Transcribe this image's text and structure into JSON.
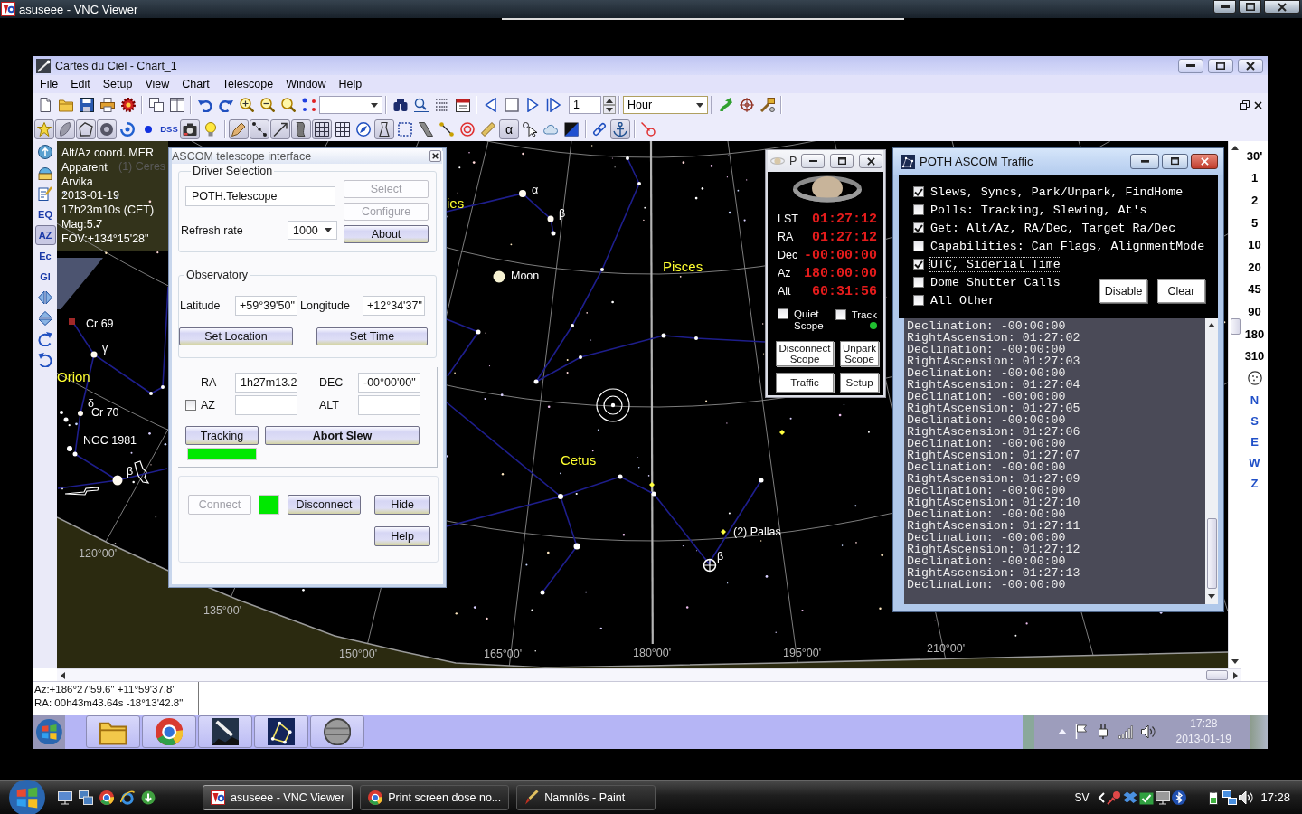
{
  "vnc_window": {
    "title": "asuseee - VNC Viewer"
  },
  "app_window": {
    "title": "Cartes du Ciel - Chart_1",
    "menu": [
      "File",
      "Edit",
      "Setup",
      "View",
      "Chart",
      "Telescope",
      "Window",
      "Help"
    ],
    "main_toolbar": {
      "step_field": "1",
      "unit_dropdown": "Hour"
    },
    "chart_toolbar": [
      {
        "kind": "icon",
        "pressed": true
      },
      {
        "kind": "icon",
        "pressed": true
      },
      {
        "kind": "icon",
        "pressed": true
      },
      {
        "kind": "icon",
        "pressed": true
      },
      {
        "kind": "icon",
        "pressed": false
      },
      {
        "kind": "icon",
        "pressed": false
      },
      {
        "kind": "text",
        "label": "DSS",
        "pressed": false
      },
      {
        "kind": "icon",
        "pressed": true
      },
      {
        "kind": "icon",
        "pressed": false
      },
      {
        "kind": "icon",
        "pressed": true
      },
      {
        "kind": "icon",
        "pressed": true
      },
      {
        "kind": "icon",
        "pressed": true
      },
      {
        "kind": "icon",
        "pressed": true
      },
      {
        "kind": "icon",
        "pressed": true
      },
      {
        "kind": "icon",
        "pressed": false
      },
      {
        "kind": "icon",
        "pressed": false
      },
      {
        "kind": "icon",
        "pressed": true
      },
      {
        "kind": "icon",
        "pressed": false
      },
      {
        "kind": "icon",
        "pressed": false
      },
      {
        "kind": "icon",
        "pressed": false
      },
      {
        "kind": "icon",
        "pressed": false
      },
      {
        "kind": "icon",
        "pressed": false
      },
      {
        "kind": "text",
        "label": "α",
        "pressed": true
      },
      {
        "kind": "icon",
        "pressed": false
      },
      {
        "kind": "icon",
        "pressed": false
      },
      {
        "kind": "icon",
        "pressed": false
      },
      {
        "kind": "icon",
        "pressed": false
      },
      {
        "kind": "icon",
        "pressed": true
      },
      {
        "kind": "icon",
        "pressed": false
      }
    ],
    "side_toolbar": [
      {
        "kind": "icon",
        "pressed": false
      },
      {
        "kind": "icon",
        "pressed": false
      },
      {
        "kind": "icon",
        "pressed": false
      },
      {
        "kind": "text",
        "label": "EQ",
        "pressed": false
      },
      {
        "kind": "text",
        "label": "AZ",
        "pressed": true
      },
      {
        "kind": "text",
        "label": "Ec",
        "pressed": false
      },
      {
        "kind": "text",
        "label": "Gl",
        "pressed": false
      },
      {
        "kind": "icon",
        "pressed": false
      },
      {
        "kind": "icon",
        "pressed": false
      },
      {
        "kind": "icon",
        "pressed": false
      },
      {
        "kind": "icon",
        "pressed": false
      }
    ],
    "chart": {
      "info": [
        "Alt/Az coord. MER",
        "Apparent",
        "Arvika",
        "2013-01-19",
        "17h23m10s (CET)",
        "Mag:5.7",
        "FOV:+134°15'28\""
      ],
      "labels": [
        {
          "text": "(1) Ceres",
          "kind": "dim"
        },
        {
          "text": "ies",
          "kind": "constellation"
        },
        {
          "text": "α",
          "kind": "object"
        },
        {
          "text": "β",
          "kind": "object"
        },
        {
          "text": "Pisces",
          "kind": "constellation"
        },
        {
          "text": "Moon",
          "kind": "object"
        },
        {
          "text": "Cr 69",
          "kind": "object"
        },
        {
          "text": "γ",
          "kind": "object"
        },
        {
          "text": "Orion",
          "kind": "constellation"
        },
        {
          "text": "δ",
          "kind": "object"
        },
        {
          "text": "Cr 70",
          "kind": "object"
        },
        {
          "text": "NGC 1981",
          "kind": "object"
        },
        {
          "text": "Cetus",
          "kind": "constellation"
        },
        {
          "text": "β",
          "kind": "object"
        },
        {
          "text": "(2) Pallas",
          "kind": "object"
        },
        {
          "text": "β",
          "kind": "object"
        },
        {
          "text": "120°00'",
          "kind": "grid"
        },
        {
          "text": "135°00'",
          "kind": "grid"
        },
        {
          "text": "150°00'",
          "kind": "grid"
        },
        {
          "text": "165°00'",
          "kind": "grid"
        },
        {
          "text": "180°00'",
          "kind": "grid"
        },
        {
          "text": "195°00'",
          "kind": "grid"
        },
        {
          "text": "210°00'",
          "kind": "grid"
        }
      ]
    },
    "fov_toolbar": {
      "fov_buttons": [
        "30'",
        "1",
        "2",
        "5",
        "10",
        "20",
        "45",
        "90",
        "180",
        "310"
      ],
      "direction_buttons": [
        "N",
        "S",
        "E",
        "W",
        "Z"
      ]
    },
    "status_bar": [
      "Az:+186°27'59.6\" +11°59'37.8\"",
      "RA: 00h43m43.64s -18°13'42.8\""
    ]
  },
  "ascom_dialog": {
    "title": "ASCOM telescope interface",
    "driver_legend": "Driver Selection",
    "driver": "POTH.Telescope",
    "driver_buttons": [
      {
        "label": "Select",
        "disabled": true
      },
      {
        "label": "Configure",
        "disabled": true
      },
      {
        "label": "About",
        "disabled": false
      }
    ],
    "refresh_label": "Refresh rate",
    "refresh_rate": "1000",
    "observatory_legend": "Observatory",
    "latitude_label": "Latitude",
    "latitude": "+59°39'50\"",
    "longitude_label": "Longitude",
    "longitude": "+12°34'37\"",
    "observatory_buttons": [
      {
        "label": "Set Location",
        "disabled": false
      },
      {
        "label": "Set Time",
        "disabled": false
      }
    ],
    "ra_label": "RA",
    "ra": "1h27m13.2",
    "dec_label": "DEC",
    "dec": "-00°00'00\"",
    "az_checkbox": {
      "label": "AZ",
      "checked": false
    },
    "alt_label": "ALT",
    "tracking_button": {
      "label": "Tracking",
      "disabled": false
    },
    "abort_button": {
      "label": "Abort Slew",
      "disabled": false
    },
    "tracking_indicator": {
      "on": true
    },
    "connection_buttons": [
      {
        "label": "Connect",
        "disabled": true
      },
      {
        "label": "Disconnect",
        "disabled": false
      },
      {
        "label": "Hide",
        "disabled": false
      },
      {
        "label": "Help",
        "disabled": false
      }
    ],
    "connection_indicator": {
      "on": true
    }
  },
  "poth_window": {
    "title": "P",
    "readouts": [
      {
        "label": "LST",
        "value": "01:27:12"
      },
      {
        "label": "RA",
        "value": "01:27:12"
      },
      {
        "label": "Dec",
        "value": "-00:00:00"
      },
      {
        "label": "Az",
        "value": "180:00:00"
      },
      {
        "label": "Alt",
        "value": "60:31:56"
      }
    ],
    "quiet_scope": {
      "label": "Quiet Scope",
      "checked": false
    },
    "track": {
      "label": "Track",
      "checked": false
    },
    "buttons": [
      "Disconnect Scope",
      "Unpark Scope",
      "Traffic",
      "Setup"
    ]
  },
  "traffic_window": {
    "title": "POTH ASCOM Traffic",
    "filters": [
      {
        "label": "Slews, Syncs, Park/Unpark, FindHome",
        "checked": true,
        "focused": false
      },
      {
        "label": "Polls: Tracking, Slewing, At's",
        "checked": false,
        "focused": false
      },
      {
        "label": "Get: Alt/Az, RA/Dec, Target Ra/Dec",
        "checked": true,
        "focused": false
      },
      {
        "label": "Capabilities: Can Flags, AlignmentMode",
        "checked": false,
        "focused": false
      },
      {
        "label": "UTC, Siderial Time",
        "checked": true,
        "focused": true
      },
      {
        "label": "Dome Shutter Calls",
        "checked": false,
        "focused": false
      },
      {
        "label": "All Other",
        "checked": false,
        "focused": false
      }
    ],
    "buttons": [
      "Disable",
      "Clear"
    ],
    "log": [
      "Declination: -00:00:00",
      "RightAscension: 01:27:02",
      "Declination: -00:00:00",
      "RightAscension: 01:27:03",
      "Declination: -00:00:00",
      "RightAscension: 01:27:04",
      "Declination: -00:00:00",
      "RightAscension: 01:27:05",
      "Declination: -00:00:00",
      "RightAscension: 01:27:06",
      "Declination: -00:00:00",
      "RightAscension: 01:27:07",
      "Declination: -00:00:00",
      "RightAscension: 01:27:09",
      "Declination: -00:00:00",
      "RightAscension: 01:27:10",
      "Declination: -00:00:00",
      "RightAscension: 01:27:11",
      "Declination: -00:00:00",
      "RightAscension: 01:27:12",
      "Declination: -00:00:00",
      "RightAscension: 01:27:13",
      "Declination: -00:00:00"
    ]
  },
  "remote_taskbar": {
    "time": "17:28",
    "date": "2013-01-19"
  },
  "taskbar": {
    "tasks": [
      {
        "label": "asuseee - VNC Viewer",
        "selected": true
      },
      {
        "label": "Print screen dose no...",
        "selected": false
      },
      {
        "label": "Namnlös - Paint",
        "selected": false
      }
    ],
    "language": "SV",
    "time": "17:28"
  }
}
